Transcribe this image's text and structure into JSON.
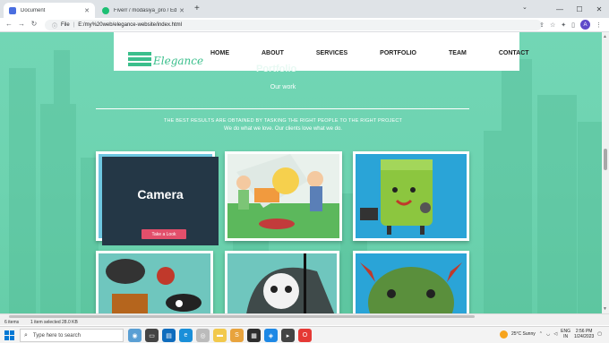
{
  "browser": {
    "tabs": [
      {
        "title": "Document",
        "favicon_color": "#4a6ee0",
        "active": true
      },
      {
        "title": "Fiverr / modasiya_pro / Edit Gig",
        "favicon_color": "#1dbf73",
        "active": false
      }
    ],
    "new_tab_label": "+",
    "window_controls": {
      "minimize": "—",
      "maximize": "☐",
      "close": "✕"
    },
    "address": {
      "scheme_label": "File",
      "url": "E:/my%20web/elegance-website/index.html"
    },
    "profile_initial": "A",
    "nav": {
      "back": "←",
      "forward": "→",
      "reload": "↻"
    }
  },
  "site": {
    "logo_text": "Elegance",
    "brand_color": "#3bbf8c",
    "menu": [
      "HOME",
      "ABOUT",
      "SERVICES",
      "PORTFOLIO",
      "TEAM",
      "CONTACT"
    ],
    "section_title": "Portfolio",
    "section_subtitle": "Our work",
    "tagline": "THE BEST RESULTS ARE OBTAINED BY TASKING THE RIGHT PEOPLE TO THE RIGHT PROJECT",
    "tagline2": "We do what we love. Our clients love what we do.",
    "overlay": {
      "title": "Camera",
      "button_label": "Take a Look",
      "button_color": "#e24f6b"
    },
    "portfolio_items": [
      {
        "icon": "camera-illustration"
      },
      {
        "icon": "workers-illustration"
      },
      {
        "icon": "green-robot-illustration"
      },
      {
        "icon": "pirates-illustration"
      },
      {
        "icon": "skeleton-illustration"
      },
      {
        "icon": "monster-illustration"
      }
    ]
  },
  "statusbar": {
    "items": "6 items",
    "selection": "1 item selected  28.0 KB"
  },
  "taskbar": {
    "search_placeholder": "Type here to search",
    "weather": "25°C  Sunny",
    "lang": "ENG",
    "lang2": "IN",
    "time": "2:56 PM",
    "date": "1/24/2023"
  }
}
